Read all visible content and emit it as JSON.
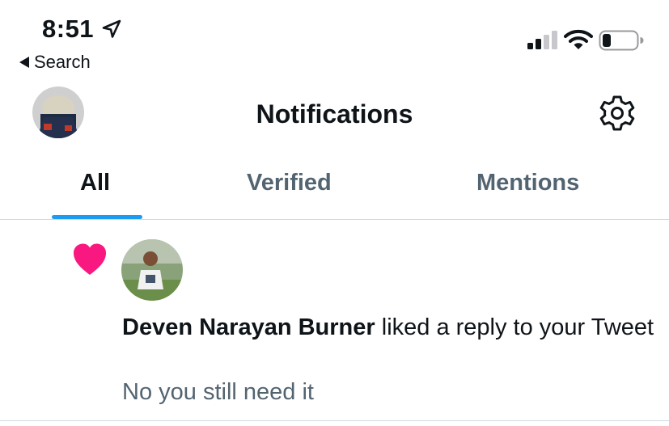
{
  "status_bar": {
    "time": "8:51",
    "back_label": "Search",
    "battery_level": 0.25
  },
  "header": {
    "title": "Notifications"
  },
  "tabs": [
    {
      "label": "All",
      "active": true
    },
    {
      "label": "Verified",
      "active": false
    },
    {
      "label": "Mentions",
      "active": false
    }
  ],
  "notifications": [
    {
      "type": "like",
      "icon": "heart-icon",
      "user_name": "Deven Narayan Burner",
      "action_text": " liked a reply to your Tweet",
      "preview": "No you still need it"
    }
  ],
  "colors": {
    "accent": "#1d9bf0",
    "like": "#f91880",
    "secondary_text": "#536471"
  }
}
